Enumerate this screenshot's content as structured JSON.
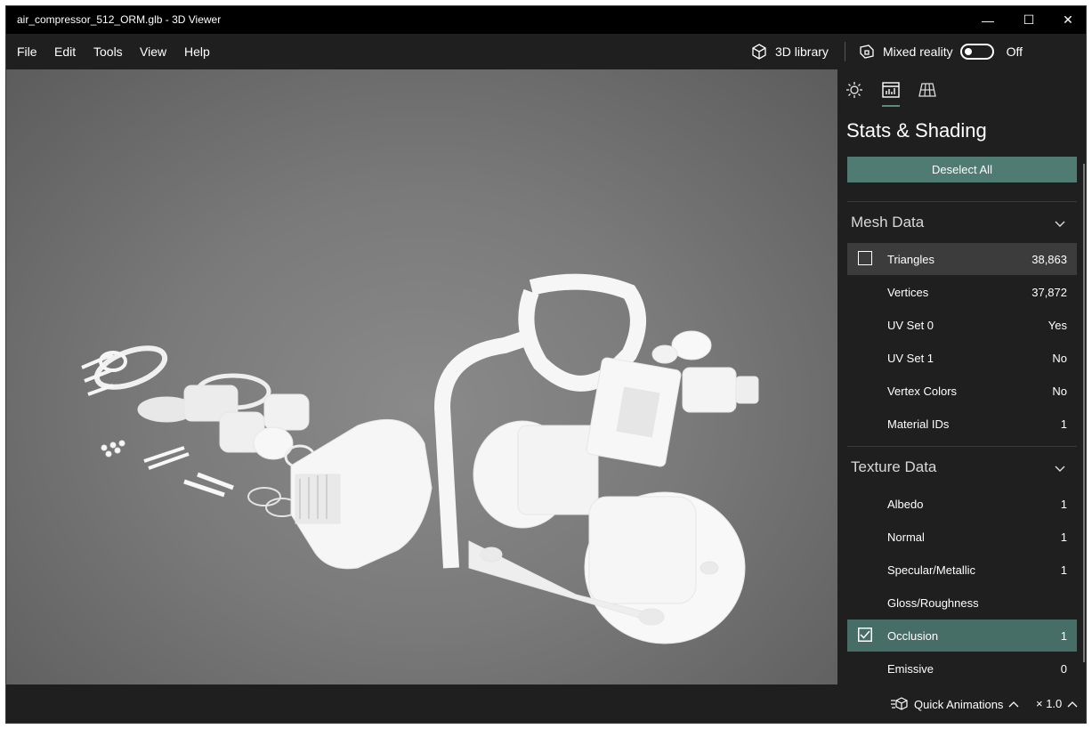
{
  "window": {
    "title": "air_compressor_512_ORM.glb - 3D Viewer",
    "controls": {
      "minimize": "—",
      "maximize": "☐",
      "close": "✕"
    }
  },
  "menu": {
    "items": [
      "File",
      "Edit",
      "Tools",
      "View",
      "Help"
    ],
    "library_label": "3D library",
    "mixed_reality_label": "Mixed reality",
    "mixed_reality_state": "Off"
  },
  "panel": {
    "title": "Stats & Shading",
    "deselect_label": "Deselect All",
    "mesh_section": "Mesh Data",
    "mesh_rows": [
      {
        "label": "Triangles",
        "value": "38,863",
        "checkbox": true,
        "checked": false
      },
      {
        "label": "Vertices",
        "value": "37,872"
      },
      {
        "label": "UV Set 0",
        "value": "Yes"
      },
      {
        "label": "UV Set 1",
        "value": "No"
      },
      {
        "label": "Vertex Colors",
        "value": "No"
      },
      {
        "label": "Material IDs",
        "value": "1"
      }
    ],
    "texture_section": "Texture Data",
    "texture_rows": [
      {
        "label": "Albedo",
        "value": "1"
      },
      {
        "label": "Normal",
        "value": "1"
      },
      {
        "label": "Specular/Metallic",
        "value": "1"
      },
      {
        "label": "Gloss/Roughness",
        "value": ""
      },
      {
        "label": "Occlusion",
        "value": "1",
        "checkbox": true,
        "checked": true
      },
      {
        "label": "Emissive",
        "value": "0"
      }
    ]
  },
  "bottom": {
    "quick_animations_label": "Quick Animations",
    "speed_label": "× 1.0"
  },
  "colors": {
    "accent": "#4f7b72",
    "active_row": "#466e66",
    "panel_bg": "#1f1f1f"
  }
}
